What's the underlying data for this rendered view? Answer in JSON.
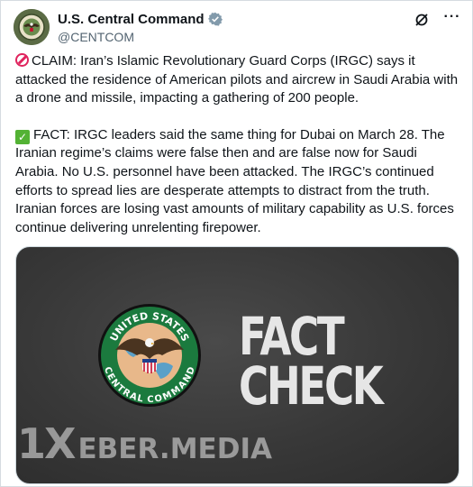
{
  "author": {
    "display_name": "U.S. Central Command",
    "handle": "@CENTCOM",
    "verified": true,
    "verified_badge_color": "#829aab",
    "avatar": "centcom-seal"
  },
  "header_actions": {
    "grok_icon": "grok-slash-icon",
    "more_label": "···"
  },
  "tweet": {
    "claim": {
      "icon": "prohibited-emoji",
      "text": "CLAIM: Iran’s Islamic Revolutionary Guard Corps (IRGC) says it attacked the residence of American pilots and aircrew in Saudi Arabia with a drone and missile, impacting a gathering of 200 people."
    },
    "fact": {
      "icon": "check-mark-button-emoji",
      "text": "FACT: IRGC leaders said the same thing for Dubai on March 28. The Iranian regime’s claims were false then and are false now for Saudi Arabia. No U.S. personnel have been attacked. The IRGC’s continued efforts to spread lies are desperate attempts to distract from the truth. Iranian forces are losing vast amounts of military capability as U.S. forces continue delivering unrelenting firepower."
    }
  },
  "media": {
    "seal": "united-states-central-command-seal",
    "seal_lettering_top": "UNITED STATES",
    "seal_lettering_bottom": "CENTRAL COMMAND",
    "headline_line1": "FACT",
    "headline_line2": "CHECK"
  },
  "watermark": {
    "prefix": "1X",
    "suffix": "EBER.MEDIA"
  },
  "colors": {
    "text": "#0f1419",
    "secondary_text": "#536471",
    "media_background": "#3a3a3a",
    "headline": "#e6e6e6",
    "claim_emoji": "#e0245e",
    "fact_emoji": "#53b234"
  }
}
